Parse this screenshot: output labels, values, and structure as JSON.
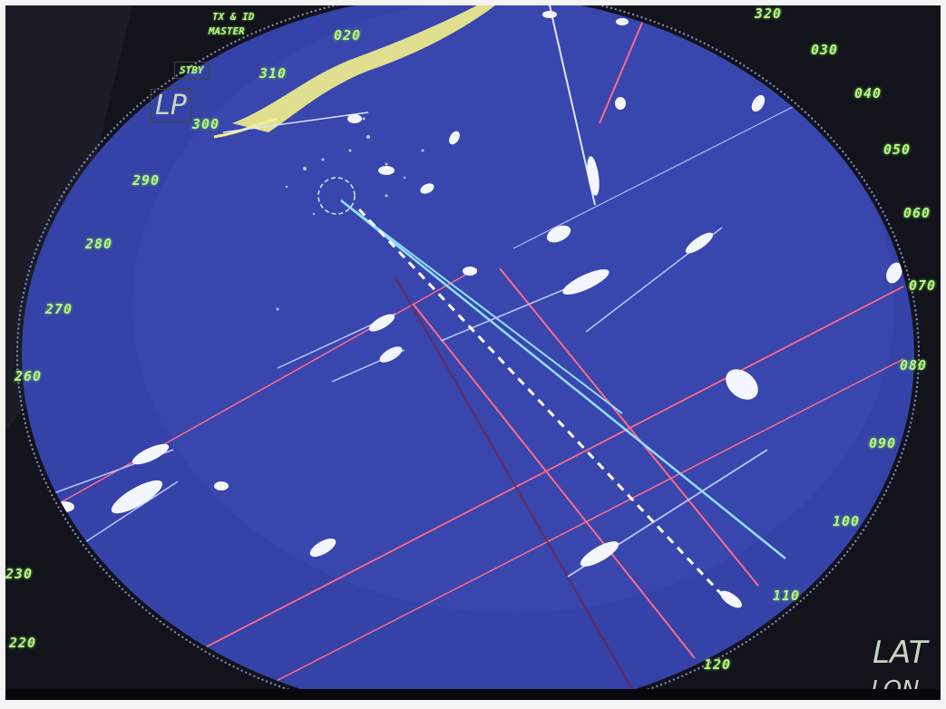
{
  "display": {
    "bearing_labels": [
      "020",
      "030",
      "040",
      "050",
      "060",
      "070",
      "080",
      "090",
      "100",
      "110",
      "120",
      "220",
      "230",
      "260",
      "270",
      "280",
      "290",
      "300",
      "310",
      "320"
    ],
    "panel_labels": {
      "mode_line1": "TX & ID",
      "mode_line2": "MASTER",
      "standby": "STBY",
      "lp": "LP",
      "lat": "LAT",
      "lon": "LON"
    }
  },
  "colors": {
    "scope_blue": "#3542a8",
    "trace_red": "#ff6a86",
    "trace_cyan": "#8fe0ff",
    "label_green": "#b8f08a",
    "coast_yellow": "#f2f08c"
  },
  "icons": [
    "radar-scope",
    "ship-echo",
    "coastline",
    "heading-line"
  ]
}
